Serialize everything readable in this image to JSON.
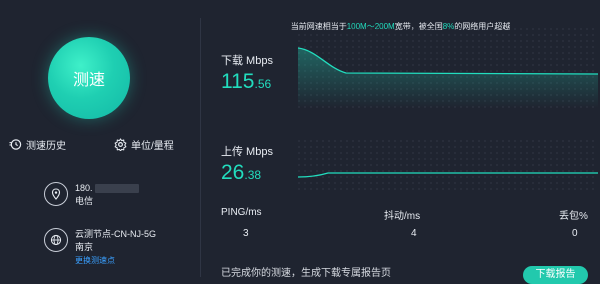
{
  "colors": {
    "accent": "#22ddbe",
    "background": "#1f2430",
    "link": "#3aa0ff"
  },
  "left": {
    "speed_button": "测速",
    "history_label": "测速历史",
    "unit_label": "单位/量程",
    "ip": {
      "prefix": "180.",
      "isp": "电信"
    },
    "node": {
      "name": "云测节点-CN-NJ-5G",
      "city": "南京",
      "change_link": "更换测速点"
    }
  },
  "banner": {
    "pre": "当前网速相当于",
    "range": "100M～200M",
    "mid": "宽带，被全国",
    "percent": "8%",
    "post": "的网络用户超越"
  },
  "download": {
    "label": "下载 Mbps",
    "int": "115",
    "dec": ".56"
  },
  "upload": {
    "label": "上传 Mbps",
    "int": "26",
    "dec": ".38"
  },
  "stats": {
    "ping_label": "PING/ms",
    "ping_value": "3",
    "jitter_label": "抖动/ms",
    "jitter_value": "4",
    "loss_label": "丢包%",
    "loss_value": "0"
  },
  "bottom": {
    "text": "已完成你的测速，生成下载专属报告页",
    "button": "下载报告"
  }
}
